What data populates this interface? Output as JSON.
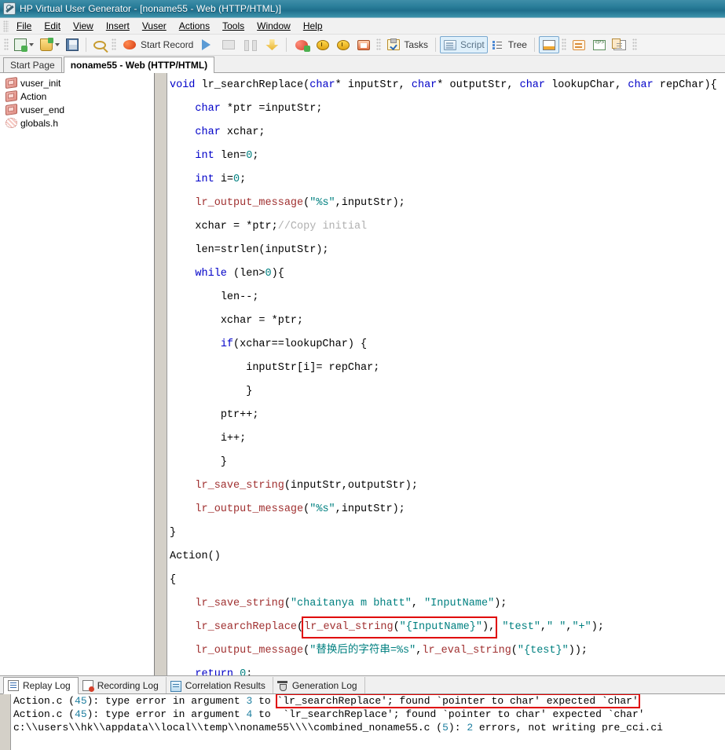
{
  "window": {
    "title": "HP Virtual User Generator - [noname55 - Web (HTTP/HTML)]",
    "icon": "vugen-app-icon"
  },
  "menubar": {
    "items": [
      {
        "label": "File"
      },
      {
        "label": "Edit"
      },
      {
        "label": "View"
      },
      {
        "label": "Insert"
      },
      {
        "label": "Vuser"
      },
      {
        "label": "Actions"
      },
      {
        "label": "Tools"
      },
      {
        "label": "Window"
      },
      {
        "label": "Help"
      }
    ]
  },
  "toolbar": {
    "new_script_icon": "new-script-icon",
    "open_icon": "open-folder-icon",
    "save_icon": "save-icon",
    "zoom_icon": "zoom-icon",
    "record_label": "Start Record",
    "record_icon": "record-icon",
    "run_icon": "run-play-icon",
    "stop_icon": "stop-icon",
    "pause_icon": "pause-icon",
    "download_icon": "download-icon",
    "correlate_icon": "correlate-icon",
    "scan_start_icon": "scan-start-icon",
    "scan_end_icon": "scan-end-icon",
    "runtime_viewer_icon": "runtime-viewer-icon",
    "tasks_label": "Tasks",
    "tasks_icon": "tasks-icon",
    "script_label": "Script",
    "script_icon": "script-view-icon",
    "tree_label": "Tree",
    "tree_icon": "tree-view-icon",
    "splitview_icon": "split-view-icon",
    "snapshot_icon": "snapshot-icon",
    "parameter_icon": "parameter-icon",
    "copy_icon": "copy-icon"
  },
  "doc_tabs": [
    {
      "label": "Start Page",
      "selected": false
    },
    {
      "label": "noname55 - Web (HTTP/HTML)",
      "selected": true
    }
  ],
  "tree": {
    "items": [
      {
        "label": "vuser_init",
        "icon": "vuser-action-icon"
      },
      {
        "label": "Action",
        "icon": "vuser-action-icon"
      },
      {
        "label": "vuser_end",
        "icon": "vuser-action-icon"
      },
      {
        "label": "globals.h",
        "icon": "header-file-icon"
      }
    ]
  },
  "editor": {
    "lines": [
      {
        "id": "l1",
        "indent": 0,
        "tokens": [
          {
            "t": "void ",
            "c": "kw"
          },
          {
            "t": "lr_searchReplace(",
            "c": ""
          },
          {
            "t": "char",
            "c": "kw"
          },
          {
            "t": "* inputStr, ",
            "c": ""
          },
          {
            "t": "char",
            "c": "kw"
          },
          {
            "t": "* outputStr, ",
            "c": ""
          },
          {
            "t": "char",
            "c": "kw"
          },
          {
            "t": " lookupChar, ",
            "c": ""
          },
          {
            "t": "char",
            "c": "kw"
          },
          {
            "t": " repChar){",
            "c": ""
          }
        ]
      },
      {
        "id": "l2",
        "indent": 1,
        "tokens": [
          {
            "t": "char",
            "c": "kw"
          },
          {
            "t": " *ptr =inputStr;",
            "c": ""
          }
        ]
      },
      {
        "id": "l3",
        "indent": 1,
        "tokens": [
          {
            "t": "char",
            "c": "kw"
          },
          {
            "t": " xchar;",
            "c": ""
          }
        ]
      },
      {
        "id": "l4",
        "indent": 1,
        "tokens": [
          {
            "t": "int",
            "c": "kw"
          },
          {
            "t": " len=",
            "c": ""
          },
          {
            "t": "0",
            "c": "num"
          },
          {
            "t": ";",
            "c": ""
          }
        ]
      },
      {
        "id": "l5",
        "indent": 1,
        "tokens": [
          {
            "t": "int",
            "c": "kw"
          },
          {
            "t": " i=",
            "c": ""
          },
          {
            "t": "0",
            "c": "num"
          },
          {
            "t": ";",
            "c": ""
          }
        ]
      },
      {
        "id": "l6",
        "indent": 1,
        "tokens": [
          {
            "t": "lr_output_message",
            "c": "fn"
          },
          {
            "t": "(",
            "c": ""
          },
          {
            "t": "\"%s\"",
            "c": "str"
          },
          {
            "t": ",inputStr);",
            "c": ""
          }
        ]
      },
      {
        "id": "l7",
        "indent": 1,
        "tokens": [
          {
            "t": "xchar = *ptr;",
            "c": ""
          },
          {
            "t": "//Copy initial",
            "c": "cmt"
          }
        ]
      },
      {
        "id": "l8",
        "indent": 1,
        "tokens": [
          {
            "t": "len=strlen(inputStr);",
            "c": ""
          }
        ]
      },
      {
        "id": "l9",
        "indent": 1,
        "tokens": [
          {
            "t": "while",
            "c": "kw"
          },
          {
            "t": " (len>",
            "c": ""
          },
          {
            "t": "0",
            "c": "num"
          },
          {
            "t": "){",
            "c": ""
          }
        ]
      },
      {
        "id": "l10",
        "indent": 2,
        "tokens": [
          {
            "t": "len--;",
            "c": ""
          }
        ]
      },
      {
        "id": "l11",
        "indent": 2,
        "tokens": [
          {
            "t": "xchar = *ptr;",
            "c": ""
          }
        ]
      },
      {
        "id": "l12",
        "indent": 2,
        "tokens": [
          {
            "t": "if",
            "c": "kw"
          },
          {
            "t": "(xchar==lookupChar) {",
            "c": ""
          }
        ]
      },
      {
        "id": "l13",
        "indent": 3,
        "tokens": [
          {
            "t": "inputStr[i]= repChar;",
            "c": ""
          }
        ]
      },
      {
        "id": "l14",
        "indent": 3,
        "tokens": [
          {
            "t": "}",
            "c": ""
          }
        ]
      },
      {
        "id": "l15",
        "indent": 2,
        "tokens": [
          {
            "t": "ptr++;",
            "c": ""
          }
        ]
      },
      {
        "id": "l16",
        "indent": 2,
        "tokens": [
          {
            "t": "i++;",
            "c": ""
          }
        ]
      },
      {
        "id": "l17",
        "indent": 2,
        "tokens": [
          {
            "t": "}",
            "c": ""
          }
        ]
      },
      {
        "id": "l18",
        "indent": 1,
        "tokens": [
          {
            "t": "lr_save_string",
            "c": "fn"
          },
          {
            "t": "(inputStr,outputStr);",
            "c": ""
          }
        ]
      },
      {
        "id": "l19",
        "indent": 1,
        "tokens": [
          {
            "t": "lr_output_message",
            "c": "fn"
          },
          {
            "t": "(",
            "c": ""
          },
          {
            "t": "\"%s\"",
            "c": "str"
          },
          {
            "t": ",inputStr);",
            "c": ""
          }
        ]
      },
      {
        "id": "l20",
        "indent": 0,
        "tokens": [
          {
            "t": "}",
            "c": ""
          }
        ]
      },
      {
        "id": "l21",
        "indent": 0,
        "tokens": [
          {
            "t": "Action()",
            "c": ""
          }
        ]
      },
      {
        "id": "l22",
        "indent": 0,
        "tokens": [
          {
            "t": "{",
            "c": ""
          }
        ]
      },
      {
        "id": "l23",
        "indent": 1,
        "tokens": [
          {
            "t": "lr_save_string",
            "c": "fn"
          },
          {
            "t": "(",
            "c": ""
          },
          {
            "t": "\"chaitanya m bhatt\"",
            "c": "str"
          },
          {
            "t": ", ",
            "c": ""
          },
          {
            "t": "\"InputName\"",
            "c": "str"
          },
          {
            "t": ");",
            "c": ""
          }
        ]
      },
      {
        "id": "l24",
        "indent": 1,
        "highlight": true,
        "tokens": [
          {
            "t": "lr_searchReplace",
            "c": "fn"
          },
          {
            "t": "(",
            "c": ""
          },
          {
            "t": "lr_eval_string",
            "c": "fn",
            "box": "start"
          },
          {
            "t": "(",
            "c": ""
          },
          {
            "t": "\"{InputName}\"",
            "c": "str"
          },
          {
            "t": "),",
            "c": "",
            "box": "end"
          },
          {
            "t": " ",
            "c": ""
          },
          {
            "t": "\"test\"",
            "c": "str"
          },
          {
            "t": ",",
            "c": ""
          },
          {
            "t": "\" \"",
            "c": "str"
          },
          {
            "t": ",",
            "c": ""
          },
          {
            "t": "\"+\"",
            "c": "str"
          },
          {
            "t": ");",
            "c": ""
          }
        ]
      },
      {
        "id": "l25",
        "indent": 1,
        "tokens": [
          {
            "t": "lr_output_message",
            "c": "fn"
          },
          {
            "t": "(",
            "c": ""
          },
          {
            "t": "\"替换后的字符串=%s\"",
            "c": "str"
          },
          {
            "t": ",",
            "c": ""
          },
          {
            "t": "lr_eval_string",
            "c": "fn"
          },
          {
            "t": "(",
            "c": ""
          },
          {
            "t": "\"{test}\"",
            "c": "str"
          },
          {
            "t": "));",
            "c": ""
          }
        ]
      },
      {
        "id": "l26",
        "indent": 1,
        "tokens": [
          {
            "t": "return",
            "c": "kw"
          },
          {
            "t": " ",
            "c": ""
          },
          {
            "t": "0",
            "c": "num"
          },
          {
            "t": ";",
            "c": ""
          }
        ]
      },
      {
        "id": "l27",
        "indent": 0,
        "tokens": [
          {
            "t": "}",
            "c": ""
          }
        ]
      }
    ]
  },
  "log_tabs": [
    {
      "label": "Replay Log",
      "icon": "replay-log-icon",
      "selected": true
    },
    {
      "label": "Recording Log",
      "icon": "recording-log-icon",
      "selected": false
    },
    {
      "label": "Correlation Results",
      "icon": "correlation-results-icon",
      "selected": false
    },
    {
      "label": "Generation Log",
      "icon": "generation-log-icon",
      "selected": false
    }
  ],
  "log_output": {
    "lines": [
      {
        "id": "log1",
        "highlight": true,
        "parts": [
          {
            "t": "Action.c (",
            "c": ""
          },
          {
            "t": "45",
            "c": "ln"
          },
          {
            "t": "): type error in argument ",
            "c": ""
          },
          {
            "t": "3",
            "c": "ln"
          },
          {
            "t": " to ",
            "c": ""
          },
          {
            "t": "`lr_searchReplace'; found `pointer to char' expected `char'",
            "c": "",
            "box": true
          }
        ]
      },
      {
        "id": "log2",
        "highlight": false,
        "parts": [
          {
            "t": "Action.c (",
            "c": ""
          },
          {
            "t": "45",
            "c": "ln"
          },
          {
            "t": "): type error in argument ",
            "c": ""
          },
          {
            "t": "4",
            "c": "ln"
          },
          {
            "t": " to  `lr_searchReplace'; found `pointer to char' expected `char'",
            "c": ""
          }
        ]
      },
      {
        "id": "log3",
        "highlight": false,
        "parts": [
          {
            "t": "c:\\\\users\\\\hk\\\\appdata\\\\local\\\\temp\\\\noname55\\\\\\\\combined_noname55.c (",
            "c": ""
          },
          {
            "t": "5",
            "c": "ln"
          },
          {
            "t": "): ",
            "c": ""
          },
          {
            "t": "2",
            "c": "ln"
          },
          {
            "t": " errors, not writing pre_cci.ci",
            "c": ""
          }
        ]
      }
    ]
  },
  "colors": {
    "titlebar_start": "#3f8ea8",
    "titlebar_end": "#1f6f8c",
    "keyword": "#0000c8",
    "function": "#a03030",
    "string": "#008080",
    "comment": "#b0b0b0",
    "highlight_box": "#e00000",
    "active_toolbtn": "#dff0fb"
  }
}
